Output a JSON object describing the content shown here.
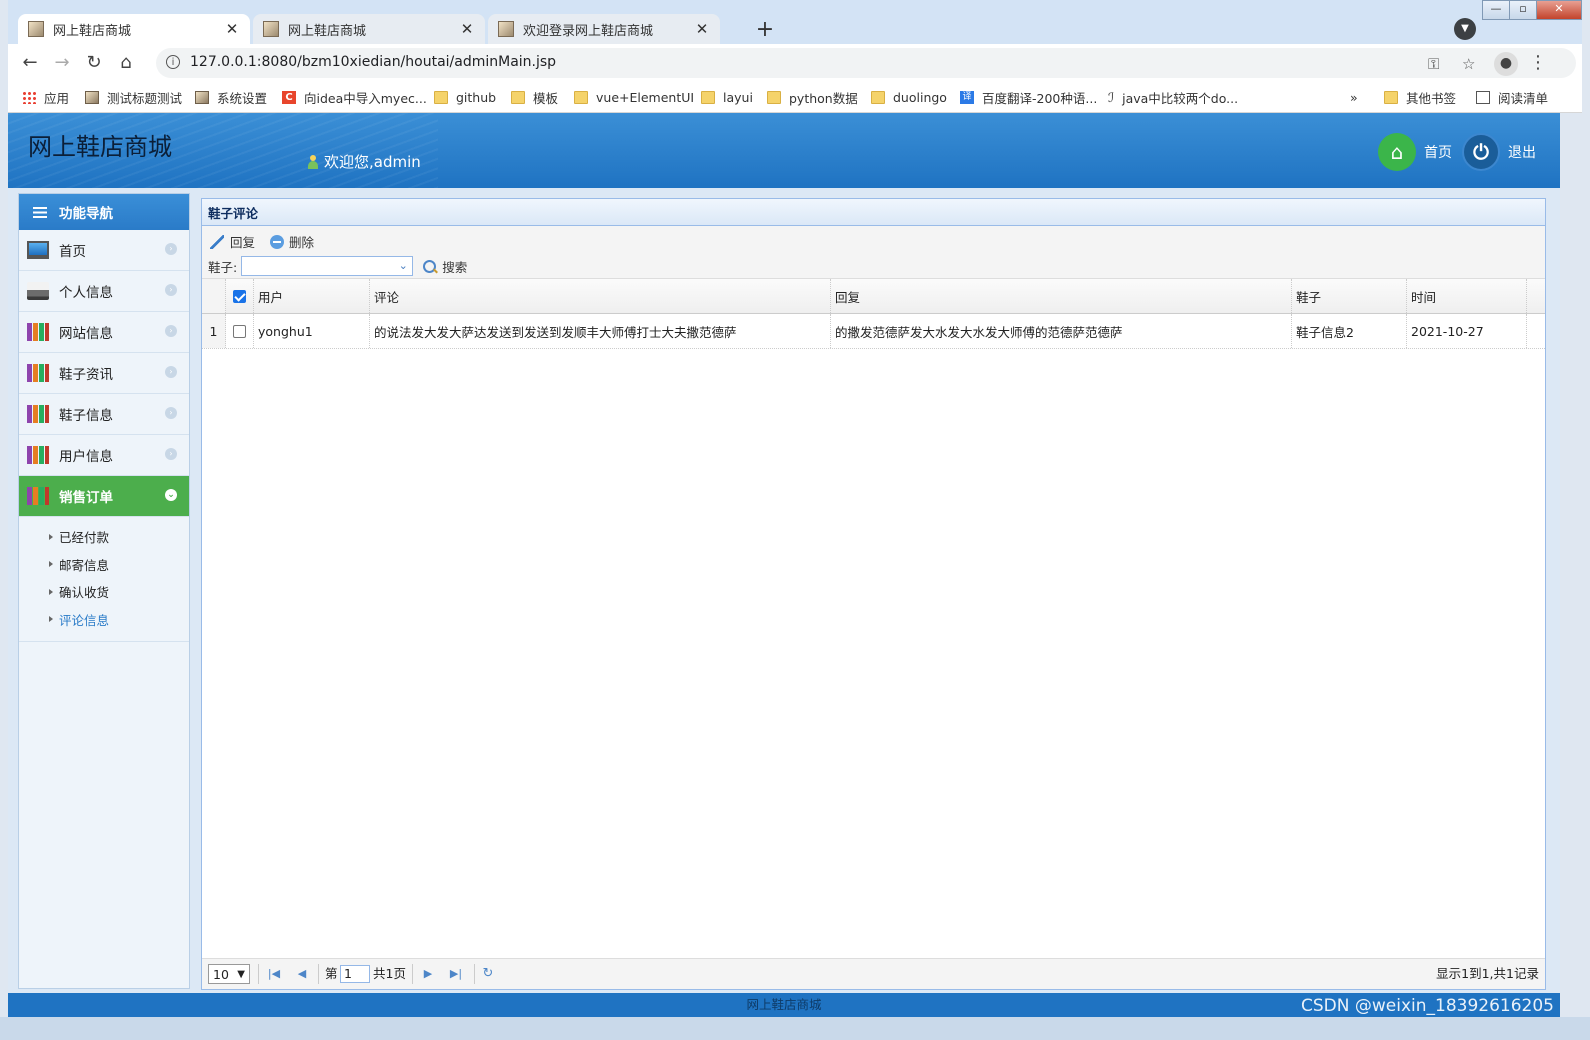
{
  "browser": {
    "tabs": [
      {
        "title": "网上鞋店商城",
        "active": true
      },
      {
        "title": "网上鞋店商城",
        "active": false
      },
      {
        "title": "欢迎登录网上鞋店商城",
        "active": false
      }
    ],
    "url": "127.0.0.1:8080/bzm10xiedian/houtai/adminMain.jsp",
    "bookmarks": [
      {
        "label": "应用",
        "icon": "apps-icon"
      },
      {
        "label": "测试标题测试",
        "icon": "page-icon"
      },
      {
        "label": "系统设置",
        "icon": "page-icon"
      },
      {
        "label": "向idea中导入myec...",
        "icon": "c-icon"
      },
      {
        "label": "github",
        "icon": "folder-icon"
      },
      {
        "label": "模板",
        "icon": "folder-icon"
      },
      {
        "label": "vue+ElementUI",
        "icon": "folder-icon"
      },
      {
        "label": "layui",
        "icon": "folder-icon"
      },
      {
        "label": "python数据",
        "icon": "folder-icon"
      },
      {
        "label": "duolingo",
        "icon": "folder-icon"
      },
      {
        "label": "百度翻译-200种语...",
        "icon": "translate-icon"
      },
      {
        "label": "java中比较两个do...",
        "icon": "link-icon"
      }
    ],
    "bookmarks_more": "»",
    "other_bookmarks": "其他书签",
    "reading_list": "阅读清单"
  },
  "header": {
    "app_title": "网上鞋店商城",
    "welcome": "欢迎您,admin",
    "home_label": "首页",
    "logout_label": "退出"
  },
  "sidebar": {
    "title": "功能导航",
    "items": [
      {
        "label": "首页",
        "icon": "monitor-icon"
      },
      {
        "label": "个人信息",
        "icon": "printer-icon"
      },
      {
        "label": "网站信息",
        "icon": "books-icon"
      },
      {
        "label": "鞋子资讯",
        "icon": "books-icon"
      },
      {
        "label": "鞋子信息",
        "icon": "books-icon"
      },
      {
        "label": "用户信息",
        "icon": "books-icon"
      },
      {
        "label": "销售订单",
        "icon": "books-icon",
        "expanded": true
      }
    ],
    "subitems": [
      {
        "label": "已经付款"
      },
      {
        "label": "邮寄信息"
      },
      {
        "label": "确认收货"
      },
      {
        "label": "评论信息",
        "current": true
      }
    ]
  },
  "panel": {
    "title": "鞋子评论",
    "reply_button": "回复",
    "delete_button": "删除",
    "filter_label": "鞋子:",
    "filter_value": "",
    "search_button": "搜索"
  },
  "table": {
    "columns": [
      "用户",
      "评论",
      "回复",
      "鞋子",
      "时间"
    ],
    "rows": [
      {
        "num": "1",
        "user": "yonghu1",
        "comment": "的说法发大发大萨达发送到发送到发顺丰大师傅打士大夫撒范德萨",
        "reply": "的撒发范德萨发大水发大水发大师傅的范德萨范德萨",
        "shoe": "鞋子信息2",
        "time": "2021-10-27"
      }
    ]
  },
  "pager": {
    "page_size": "10",
    "page_prefix": "第",
    "current_page": "1",
    "total_pages": "共1页",
    "summary": "显示1到1,共1记录"
  },
  "footer": {
    "text": "网上鞋店商城",
    "watermark": "CSDN @weixin_18392616205"
  }
}
